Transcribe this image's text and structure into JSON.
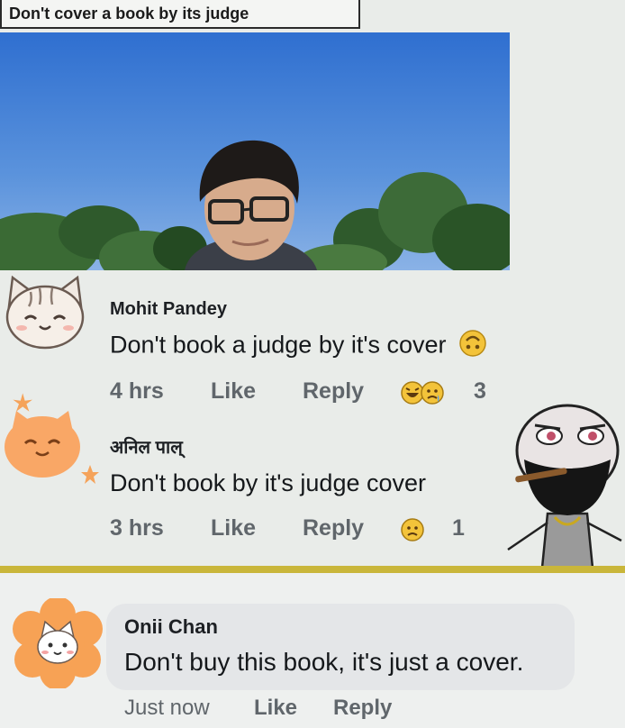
{
  "post": {
    "title": "Don't cover a book by its judge"
  },
  "comments": [
    {
      "author": "Mohit Pandey",
      "text": "Don't book a judge by it's cover",
      "time": "4 hrs",
      "like_label": "Like",
      "reply_label": "Reply",
      "reaction_count": "3",
      "reactions": [
        "haha-emoji",
        "sad-emoji"
      ],
      "trailing_emoji": "upside-down-face-emoji"
    },
    {
      "author": "अनिल पाल्",
      "text": "Don't book by it's judge cover",
      "time": "3 hrs",
      "like_label": "Like",
      "reply_label": "Reply",
      "reaction_count": "1",
      "reactions": [
        "sad-emoji"
      ]
    },
    {
      "author": "Onii Chan",
      "text": "Don't buy this book, it's just a cover.",
      "time": "Just now",
      "like_label": "Like",
      "reply_label": "Reply"
    }
  ],
  "colors": {
    "background": "#e9ece9",
    "divider": "#c9b63a",
    "meta_text": "#60666b",
    "sky": "#3f7fd6"
  }
}
